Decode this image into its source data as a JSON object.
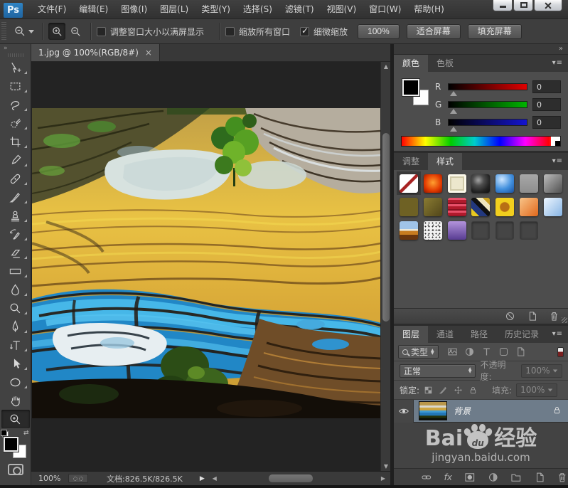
{
  "window": {
    "logo": "Ps",
    "controls": {
      "minimize": "minimize",
      "maximize": "maximize",
      "close": "close"
    }
  },
  "menu_bar": {
    "items": [
      "文件(F)",
      "编辑(E)",
      "图像(I)",
      "图层(L)",
      "类型(Y)",
      "选择(S)",
      "滤镜(T)",
      "视图(V)",
      "窗口(W)",
      "帮助(H)"
    ]
  },
  "options_bar": {
    "checkboxes": [
      {
        "label": "调整窗口大小以满屏显示",
        "checked": false
      },
      {
        "label": "缩放所有窗口",
        "checked": false
      },
      {
        "label": "细微缩放",
        "checked": true
      }
    ],
    "zoom_value": "100%",
    "fit_screen": "适合屏幕",
    "fill_screen": "填充屏幕"
  },
  "toolbar": {
    "collapse": "»",
    "tools": [
      "move",
      "rectangular-marquee",
      "lasso",
      "quick-selection",
      "crop",
      "eyedropper",
      "spot-healing-brush",
      "brush",
      "clone-stamp",
      "history-brush",
      "eraser",
      "gradient",
      "blur",
      "dodge",
      "pen",
      "type",
      "path-selection",
      "ellipse-shape",
      "hand",
      "zoom"
    ],
    "active_tool": "zoom"
  },
  "document": {
    "tab_title": "1.jpg @ 100%(RGB/8#)",
    "close_glyph": "×",
    "image_alt": "terraced-rice-fields-photo",
    "status": {
      "zoom": "100%",
      "doc_info": "文档:826.5K/826.5K"
    }
  },
  "dock": {
    "collapse": "»",
    "panel_menu_glyph": "▾≡"
  },
  "color_panel": {
    "tabs": [
      "颜色",
      "色板"
    ],
    "active_tab": "颜色",
    "channels": [
      {
        "label": "R",
        "value": "0"
      },
      {
        "label": "G",
        "value": "0"
      },
      {
        "label": "B",
        "value": "0"
      }
    ]
  },
  "styles_panel": {
    "tabs": [
      "调整",
      "样式"
    ],
    "active_tab": "样式",
    "swatches": [
      "no-style",
      "orange-glow",
      "ivory-frame",
      "dark-sphere",
      "blue-gloss",
      "gray-flat",
      "gray-gradient",
      "olive-flat",
      "olive-gradient",
      "red-stripes",
      "color-mosaic",
      "yellow-inset",
      "orange-gradient",
      "sky-blue-gloss",
      "landscape",
      "noise-speckle",
      "purple-gradient",
      "empty",
      "empty",
      "empty"
    ],
    "selected_swatch": "no-style"
  },
  "layers_panel": {
    "tabs": [
      "图层",
      "通道",
      "路径",
      "历史记录"
    ],
    "active_tab": "图层",
    "filter_label": "类型",
    "blend_mode": "正常",
    "opacity_label": "不透明度:",
    "opacity_value": "100%",
    "lock_label": "锁定:",
    "fill_label": "填充:",
    "fill_value": "100%",
    "footer_fx": "fx",
    "layers": [
      {
        "name": "背景",
        "visible": true,
        "locked": true
      }
    ]
  },
  "watermark": {
    "brand_prefix": "Bai",
    "brand_paw": "du",
    "brand_suffix": "经验",
    "url": "jingyan.baidu.com"
  }
}
